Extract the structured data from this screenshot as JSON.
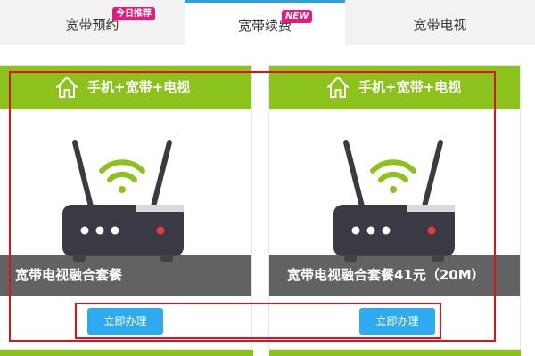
{
  "tabs": [
    {
      "label": "宽带预约",
      "badge": "今日推荐"
    },
    {
      "label": "宽带续费",
      "badge": "NEW"
    },
    {
      "label": "宽带电视",
      "badge": ""
    }
  ],
  "cards": [
    {
      "header": "手机+宽带+电视",
      "caption": "宽带电视融合套餐",
      "button": "立即办理"
    },
    {
      "header": "手机+宽带+电视",
      "caption": "宽带电视融合套餐41元（20M）",
      "button": "立即办理"
    }
  ],
  "colors": {
    "accent_green": "#8cc21c",
    "button_blue": "#2eabf0",
    "tab_active_border": "#2d9fe8",
    "badge_pink": "#e6197d",
    "highlight_red": "#d9151b"
  },
  "icons": [
    "home-icon",
    "router-icon",
    "wifi-icon"
  ]
}
